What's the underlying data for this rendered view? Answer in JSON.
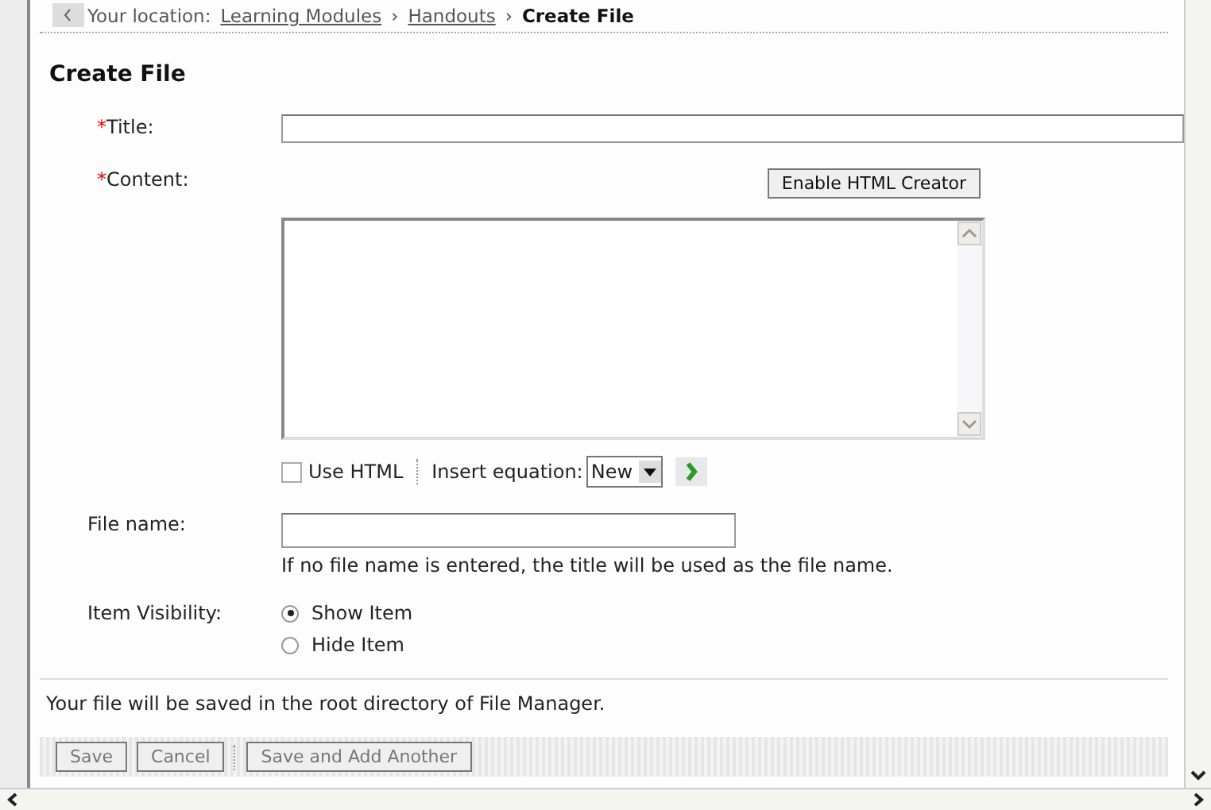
{
  "breadcrumb": {
    "label": "Your location:",
    "separators": [
      "›",
      "›"
    ],
    "items": [
      {
        "text": "Learning Modules",
        "kind": "link"
      },
      {
        "text": "Handouts",
        "kind": "link"
      },
      {
        "text": "Create File",
        "kind": "current"
      }
    ]
  },
  "heading": "Create File",
  "form": {
    "title": {
      "required_mark": "*",
      "label": "Title:"
    },
    "content": {
      "required_mark": "*",
      "label": "Content:",
      "button": "Enable HTML Creator"
    },
    "use_html": {
      "label": "Use HTML",
      "checked": false
    },
    "insert_equation": {
      "label": "Insert equation:",
      "value": "New"
    },
    "file_name": {
      "label": "File name:",
      "hint": "If no file name is entered, the title will be used as the file name."
    },
    "visibility": {
      "label": "Item Visibility:",
      "options": [
        {
          "label": "Show Item",
          "selected": true
        },
        {
          "label": "Hide Item",
          "selected": false
        }
      ]
    }
  },
  "note": "Your file will be saved in the root directory of File Manager.",
  "button_groups": [
    [
      "Save",
      "Cancel"
    ],
    [
      "Save and Add Another"
    ]
  ]
}
